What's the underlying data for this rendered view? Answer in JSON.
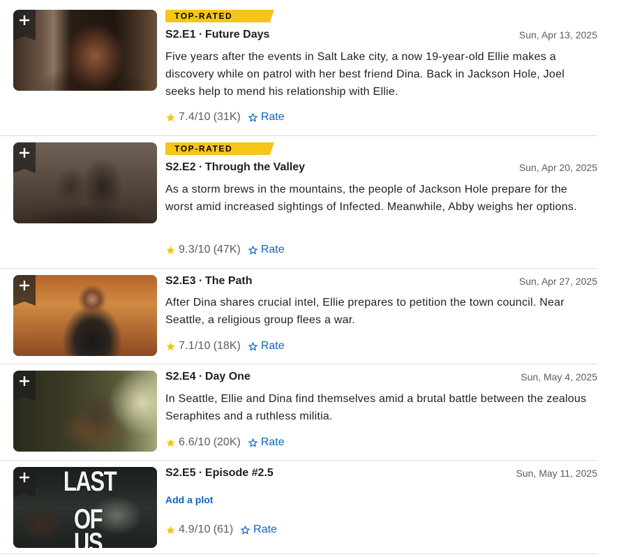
{
  "colors": {
    "accent_yellow": "#f5c518",
    "link_blue": "#0e63be",
    "text_primary": "#1f1f1f",
    "text_secondary": "#5c5c5c",
    "divider": "#dcdcdc"
  },
  "episodes": [
    {
      "badge": "TOP-RATED",
      "title": "S2.E1 ∙ Future Days",
      "date": "Sun, Apr 13, 2025",
      "plot": "Five years after the events in Salt Lake city, a now 19-year-old Ellie makes a discovery while on patrol with her best friend Dina. Back in Jackson Hole, Joel seeks help to mend his relationship with Ellie.",
      "rating": "7.4/10",
      "votes": "(31K)",
      "rate_label": "Rate"
    },
    {
      "badge": "TOP-RATED",
      "title": "S2.E2 ∙ Through the Valley",
      "date": "Sun, Apr 20, 2025",
      "plot": "As a storm brews in the mountains, the people of Jackson Hole prepare for the worst amid increased sightings of Infected. Meanwhile, Abby weighs her options.",
      "rating": "9.3/10",
      "votes": "(47K)",
      "rate_label": "Rate"
    },
    {
      "title": "S2.E3 ∙ The Path",
      "date": "Sun, Apr 27, 2025",
      "plot": "After Dina shares crucial intel, Ellie prepares to petition the town council. Near Seattle, a religious group flees a war.",
      "rating": "7.1/10",
      "votes": "(18K)",
      "rate_label": "Rate"
    },
    {
      "title": "S2.E4 ∙ Day One",
      "date": "Sun, May 4, 2025",
      "plot": "In Seattle, Ellie and Dina find themselves amid a brutal battle between the zealous Seraphites and a ruthless militia.",
      "rating": "6.6/10",
      "votes": "(20K)",
      "rate_label": "Rate"
    },
    {
      "title": "S2.E5 ∙ Episode #2.5",
      "date": "Sun, May 11, 2025",
      "add_plot_label": "Add a plot",
      "thumb_logo_top": "LAST",
      "thumb_logo_bottom": "OF US",
      "rating": "4.9/10",
      "votes": "(61)",
      "rate_label": "Rate"
    }
  ]
}
